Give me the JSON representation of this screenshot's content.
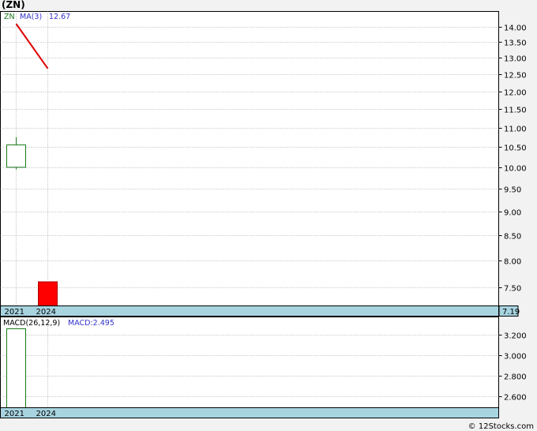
{
  "title": "(ZN)",
  "chart_data": [
    {
      "type": "candlestick",
      "ticker": "ZN",
      "legend": {
        "ticker_label": "ZN",
        "ma_label": "MA(3)",
        "ma_value": "12.67"
      },
      "categories": [
        "2021",
        "2024"
      ],
      "candles": [
        {
          "x": "2021",
          "open": 10.0,
          "close": 10.55,
          "high": 10.75,
          "low": 9.95,
          "direction": "up"
        },
        {
          "x": "2024",
          "open": 7.6,
          "close": 7.19,
          "high": 7.6,
          "low": 7.19,
          "direction": "down"
        }
      ],
      "ma_line": {
        "name": "MA(3)",
        "points": [
          {
            "x": "2021",
            "y": 14.1
          },
          {
            "x": "2024",
            "y": 12.67
          }
        ]
      },
      "y_ticks": [
        "14.00",
        "13.50",
        "13.00",
        "12.50",
        "12.00",
        "11.50",
        "11.00",
        "10.50",
        "10.00",
        "9.50",
        "9.00",
        "8.50",
        "8.00",
        "7.50"
      ],
      "last_price_label": "7.19",
      "x_labels": [
        "2021",
        "2024"
      ],
      "grid": true,
      "colors": {
        "up": "#1a7a1a",
        "down": "#ff0000",
        "ma": "#dd0000",
        "axis_band": "#a8d4e0",
        "legend_ticker": "#1a7a1a",
        "legend_ma": "#3333cc"
      }
    },
    {
      "type": "bar",
      "label": "MACD(26,12,9)",
      "value_label": "MACD:2.495",
      "categories": [
        "2021"
      ],
      "values": [
        3.3
      ],
      "y_ticks": [
        "3.200",
        "3.000",
        "2.800",
        "2.600"
      ],
      "x_labels": [
        "2021",
        "2024"
      ],
      "grid": true
    }
  ],
  "footer": {
    "copyright": "© 12Stocks.com"
  }
}
